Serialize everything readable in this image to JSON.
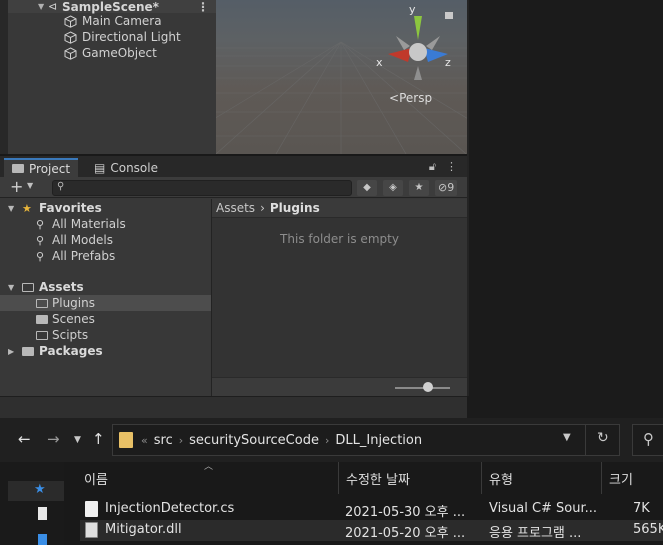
{
  "hierarchy": {
    "scene_name": "SampleScene*",
    "items": [
      "Main Camera",
      "Directional Light",
      "GameObject"
    ]
  },
  "scene_view": {
    "gizmo_labels": {
      "y": "y",
      "x": "x",
      "z": "z"
    },
    "projection_label": "Persp"
  },
  "project_panel": {
    "tabs": [
      {
        "label": "Project"
      },
      {
        "label": "Console"
      }
    ],
    "hidden_count": "9",
    "favorites": {
      "label": "Favorites",
      "items": [
        "All Materials",
        "All Models",
        "All Prefabs"
      ]
    },
    "assets": {
      "label": "Assets",
      "folders": [
        "Plugins",
        "Scenes",
        "Scipts"
      ],
      "selected": "Plugins"
    },
    "packages_label": "Packages",
    "breadcrumb": [
      "Assets",
      "Plugins"
    ],
    "empty_message": "This folder is empty",
    "zoom_level": 0.6
  },
  "explorer": {
    "path": [
      "src",
      "securitySourceCode",
      "DLL_Injection"
    ],
    "columns": [
      "이름",
      "수정한 날짜",
      "유형",
      "크기"
    ],
    "files": [
      {
        "name": "InjectionDetector.cs",
        "date": "2021-05-30 오후 ...",
        "type": "Visual C# Sour...",
        "size": "7K"
      },
      {
        "name": "Mitigator.dll",
        "date": "2021-05-20 오후 ...",
        "type": "응용 프로그램 ...",
        "size": "565K"
      }
    ],
    "selected_file": "Mitigator.dll"
  },
  "colors": {
    "unity_panel": "#383838",
    "selection": "#4d4d4d",
    "tab_accent": "#3a79bb",
    "explorer_bg": "#191919",
    "folder_yellow": "#e8c066",
    "gizmo_x": "#c0392b",
    "gizmo_y": "#8cc63f",
    "gizmo_z": "#3a7bd5"
  }
}
